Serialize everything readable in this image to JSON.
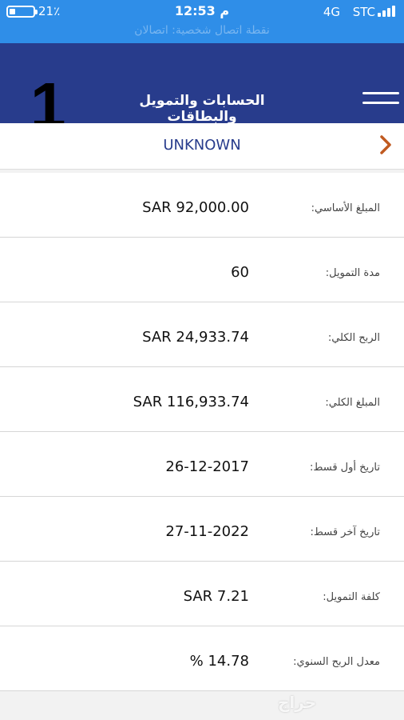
{
  "status_bar": {
    "battery_percent": "21٪",
    "battery_level": 0.21,
    "time": "12:53 م",
    "network": "4G",
    "carrier": "STC",
    "ghost_text": "نقطة اتصال شخصية: اتصالان"
  },
  "header": {
    "badge_number": "1",
    "title": "الحسابات والتمويل والبطاقات",
    "background": "#283c8c",
    "menu_icon": "hamburger-menu-icon"
  },
  "account": {
    "name": "UNKNOWN",
    "chevron_icon": "chevron-right-icon",
    "chevron_color": "#c05a20"
  },
  "rows": [
    {
      "label": "المبلغ الأساسي:",
      "value": "SAR 92,000.00"
    },
    {
      "label": "مدة التمويل:",
      "value": "60"
    },
    {
      "label": "الربح الكلي:",
      "value": "SAR 24,933.74"
    },
    {
      "label": "المبلغ الكلي:",
      "value": "SAR 116,933.74"
    },
    {
      "label": "تاريخ أول قسط:",
      "value": "26-12-2017"
    },
    {
      "label": "تاريخ آخر قسط:",
      "value": "27-11-2022"
    },
    {
      "label": "كلفة التمويل:",
      "value": "SAR 7.21"
    },
    {
      "label": "معدل الربح السنوي:",
      "value": "% 14.78"
    }
  ],
  "watermark": "حراج"
}
